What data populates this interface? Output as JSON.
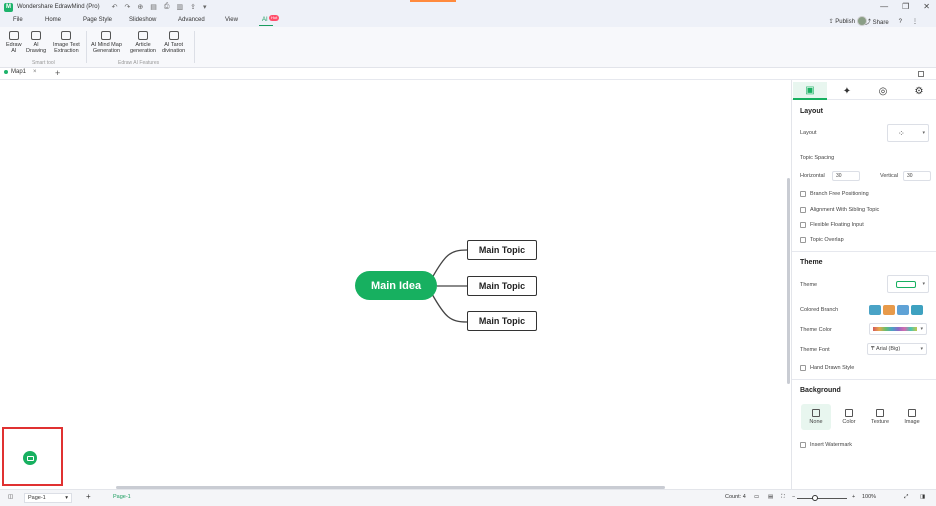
{
  "titlebar": {
    "app_title": "Wondershare EdrawMind (Pro)",
    "quick_access": [
      "↶",
      "↷",
      "⊕",
      "▤",
      "⎙",
      "▥",
      "⇪",
      "▾"
    ],
    "window_controls": [
      "—",
      "❐",
      "✕"
    ]
  },
  "menu": {
    "items": [
      "File",
      "Home",
      "Page Style",
      "Slideshow",
      "Advanced",
      "View",
      "AI"
    ],
    "active": "AI",
    "ai_badge": "Hot",
    "publish": "Publish",
    "share": "Share",
    "help": "?",
    "more": "⋮"
  },
  "ribbon": {
    "smart_tool": [
      {
        "line1": "Edraw",
        "line2": "AI"
      },
      {
        "line1": "AI",
        "line2": "Drawing"
      },
      {
        "line1": "Image Text",
        "line2": "Extraction"
      }
    ],
    "smart_tool_label": "Smart tool",
    "features": [
      {
        "line1": "AI Mind Map",
        "line2": "Generation"
      },
      {
        "line1": "Article",
        "line2": "generation"
      },
      {
        "line1": "AI Tarot",
        "line2": "divination"
      }
    ],
    "features_label": "Edraw AI Features"
  },
  "tabs": {
    "doc_tab": "Map1",
    "close": "×",
    "add": "+"
  },
  "mindmap": {
    "central": "Main Idea",
    "topics": [
      "Main Topic",
      "Main Topic",
      "Main Topic"
    ],
    "central_color": "#17b060"
  },
  "panel": {
    "layout_title": "Layout",
    "layout_label": "Layout",
    "topic_spacing": "Topic Spacing",
    "horizontal_label": "Horizontal",
    "horizontal_value": "30",
    "vertical_label": "Vertical",
    "vertical_value": "30",
    "layout_checks": [
      "Branch Free Positioning",
      "Alignment With Sibling Topic",
      "Flexible Floating Input",
      "Topic Overlap"
    ],
    "theme_title": "Theme",
    "theme_label": "Theme",
    "colored_branch": "Colored Branch",
    "theme_color": "Theme Color",
    "theme_font": "Theme Font",
    "theme_font_value": "Arial (Big)",
    "hand_drawn": "Hand Drawn Style",
    "background_title": "Background",
    "bg_options": [
      "None",
      "Color",
      "Texture",
      "Image"
    ],
    "bg_selected": "None",
    "insert_watermark": "Insert Watermark",
    "accent": "#17b060"
  },
  "status": {
    "page_select": "Page-1",
    "add_page": "+",
    "page_tab": "Page-1",
    "count": "Count: 4",
    "zoom_minus": "−",
    "zoom_plus": "+",
    "zoom_value": "100%"
  }
}
